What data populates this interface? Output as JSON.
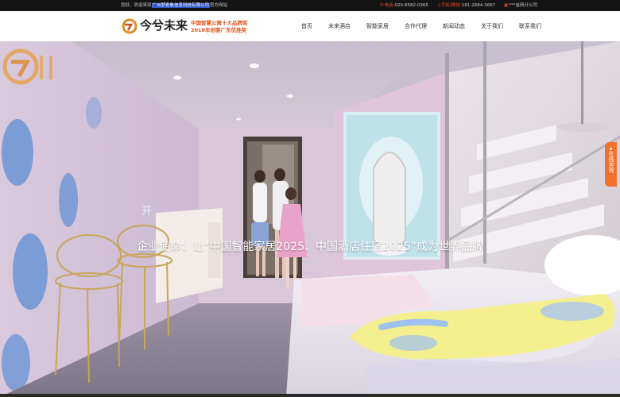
{
  "topbar": {
    "greeting": "您好，欢迎来到",
    "company": "广州梦奇象信息科技有限公司",
    "greeting_suffix": "官方网站",
    "phone_label": "电话:",
    "phone": "020-8582-0365",
    "mobile_label": "手机/微信:",
    "mobile": "181-2684-3667",
    "extra": "***金网分公司"
  },
  "header": {
    "logo_text": "今兮未来",
    "award_line1": "中国智慧公寓十大品牌奖",
    "award_line2": "2018年创客广东优胜奖",
    "nav": [
      "首页",
      "未来酒店",
      "智能家居",
      "合作代理",
      "新闻动态",
      "关于我们",
      "联系我们"
    ]
  },
  "hero": {
    "mission": "企业使命：让“中国智能家居2025、中国酒店住宿2025”成为世界品牌",
    "mark_text": "开",
    "online_button": "在线咨询",
    "colors": {
      "accent": "#f1702a",
      "brand_orange": "#e0561e"
    },
    "icons": [
      "logo-mark-icon",
      "phone-icon",
      "mobile-icon",
      "watermark-logo-icon"
    ]
  }
}
